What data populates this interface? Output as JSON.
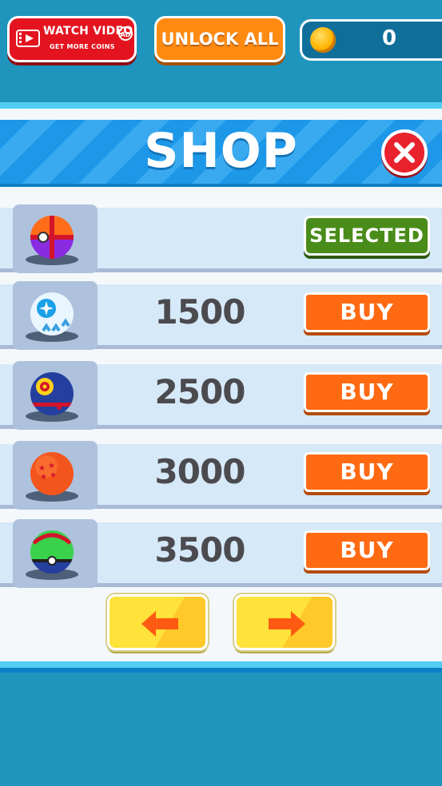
{
  "topbar": {
    "watch_video": {
      "title": "WATCH VIDEO",
      "subtitle": "GET MORE COINS",
      "badge": "AD"
    },
    "unlock_all_label": "UNLOCK ALL",
    "coins": {
      "icon": "coin-icon",
      "count": "0"
    }
  },
  "shop": {
    "title": "SHOP",
    "close_icon": "close-icon",
    "items": [
      {
        "ball": "pokeball-orange-purple",
        "price": "",
        "action": "SELECTED",
        "state": "selected"
      },
      {
        "ball": "white-blue-ball",
        "price": "1500",
        "action": "BUY",
        "state": "buy"
      },
      {
        "ball": "blue-red-flower-ball",
        "price": "2500",
        "action": "BUY",
        "state": "buy"
      },
      {
        "ball": "dragon-ball-orange",
        "price": "3000",
        "action": "BUY",
        "state": "buy"
      },
      {
        "ball": "green-red-ball",
        "price": "3500",
        "action": "BUY",
        "state": "buy"
      }
    ],
    "nav": {
      "prev_icon": "arrow-left-icon",
      "next_icon": "arrow-right-icon"
    }
  },
  "colors": {
    "background": "#1f95be",
    "buy": "#ff6a12",
    "selected": "#4a8c1a",
    "header": "#1d97e8",
    "arrow_button": "#ffe23a"
  }
}
